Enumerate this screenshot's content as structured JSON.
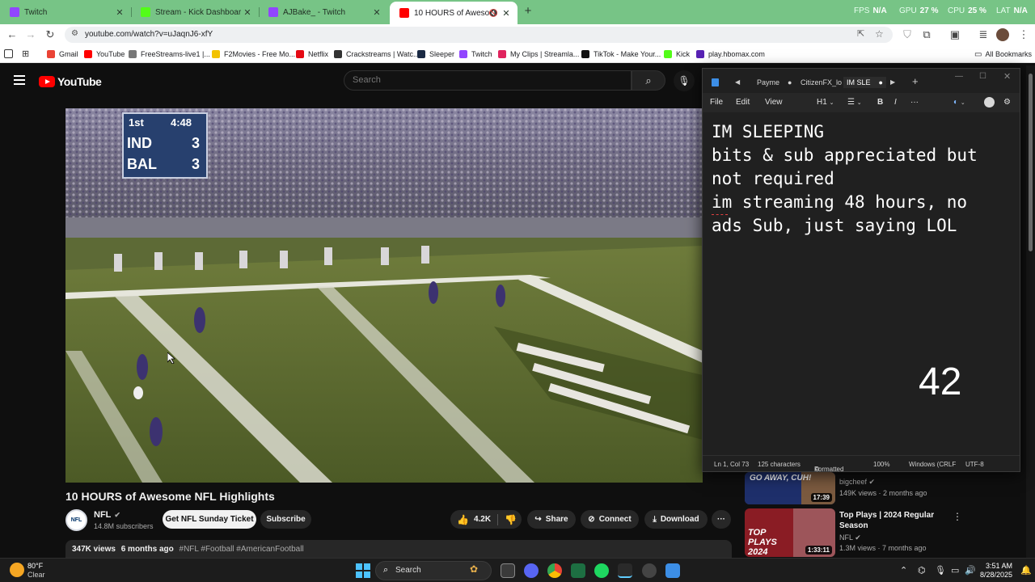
{
  "browser": {
    "tabs": [
      {
        "title": "Twitch",
        "favicon_color": "#9146ff"
      },
      {
        "title": "Stream - Kick Dashboard",
        "favicon_color": "#53fc18"
      },
      {
        "title": "AJBake_ - Twitch",
        "favicon_color": "#9146ff"
      },
      {
        "title": "10 HOURS of Awesome NFL",
        "favicon_color": "#ff0000",
        "active": true
      }
    ],
    "new_tab_label": "+",
    "perf": {
      "fps_label": "FPS",
      "fps_value": "N/A",
      "gpu_label": "GPU",
      "gpu_value": "27 %",
      "cpu_label": "CPU",
      "cpu_value": "25 %",
      "lat_label": "LAT",
      "lat_value": "N/A"
    },
    "url": "youtube.com/watch?v=uJaqnJ6-xfY",
    "bookmarks": [
      {
        "label": "Gmail",
        "color": "#ea4335"
      },
      {
        "label": "YouTube",
        "color": "#ff0000"
      },
      {
        "label": "FreeStreams-live1 |...",
        "color": "#777777"
      },
      {
        "label": "F2Movies - Free Mo...",
        "color": "#f2c200"
      },
      {
        "label": "Netflix",
        "color": "#e50914"
      },
      {
        "label": "Crackstreams | Watc...",
        "color": "#333333"
      },
      {
        "label": "Sleeper",
        "color": "#1a2a44"
      },
      {
        "label": "Twitch",
        "color": "#9146ff"
      },
      {
        "label": "My Clips | Streamla...",
        "color": "#e0245e"
      },
      {
        "label": "TikTok - Make Your...",
        "color": "#111111"
      },
      {
        "label": "Kick",
        "color": "#53fc18"
      },
      {
        "label": "play.hbomax.com",
        "color": "#5822b4"
      }
    ],
    "all_bookmarks": "All Bookmarks"
  },
  "youtube": {
    "logo_text": "YouTube",
    "search_placeholder": "Search",
    "video": {
      "scorebug": {
        "quarter": "1st",
        "clock": "4:48",
        "team1": "IND",
        "score1": "3",
        "team2": "BAL",
        "score2": "3"
      },
      "title": "10 HOURS of Awesome NFL Highlights",
      "channel": "NFL",
      "channel_avatar_text": "NFL",
      "subscribers": "14.8M subscribers",
      "ticket_label": "Get NFL Sunday Ticket",
      "subscribe_label": "Subscribe",
      "likes": "4.2K",
      "share_label": "Share",
      "connect_label": "Connect",
      "download_label": "Download",
      "more_label": "···",
      "views": "347K views",
      "age": "6 months ago",
      "hashtags": "#NFL #Football #AmericanFootball"
    },
    "related": [
      {
        "thumb_text": "GO AWAY, CUH!",
        "duration": "17:39",
        "title": "",
        "channel": "bigcheef",
        "meta": "149K views · 2 months ago"
      },
      {
        "thumb_text": "TOP PLAYS 2024",
        "duration": "1:33:11",
        "title": "Top Plays | 2024 Regular Season",
        "channel": "NFL",
        "meta": "1.3M views · 7 months ago"
      }
    ]
  },
  "notepad": {
    "tabs": [
      "Payme",
      "CitizenFX_lo",
      "IM SLE"
    ],
    "menu": [
      "File",
      "Edit",
      "View"
    ],
    "heading_label": "H1",
    "text": "IM SLEEPING\nbits & sub appreciated but\nnot required\nim streaming 48 hours, no\nads Sub, just saying LOL",
    "counter": "42",
    "status": {
      "position": "Ln 1, Col 73",
      "characters": "125 characters",
      "mode": "Formatted",
      "zoom": "100%",
      "line_ending": "Windows (CRLF",
      "encoding": "UTF-8"
    }
  },
  "taskbar": {
    "weather_temp": "80°F",
    "weather_desc": "Clear",
    "search_label": "Search",
    "time": "3:51 AM",
    "date": "8/28/2025"
  }
}
